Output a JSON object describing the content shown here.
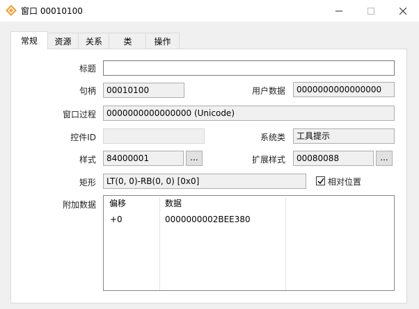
{
  "window": {
    "title": "窗口 00010100",
    "controls": [
      "minimize",
      "maximize",
      "close"
    ]
  },
  "tabs": [
    {
      "label": "常规",
      "active": true
    },
    {
      "label": "资源",
      "active": false
    },
    {
      "label": "关系",
      "active": false
    },
    {
      "label": "类",
      "active": false
    },
    {
      "label": "操作",
      "active": false
    }
  ],
  "general": {
    "title_label": "标题",
    "title_value": "",
    "handle_label": "句柄",
    "handle_value": "00010100",
    "userdata_label": "用户数据",
    "userdata_value": "0000000000000000",
    "wndproc_label": "窗口过程",
    "wndproc_value": "0000000000000000 (Unicode)",
    "ctrlid_label": "控件ID",
    "ctrlid_value": "",
    "sysclass_label": "系统类",
    "sysclass_value": "工具提示",
    "style_label": "样式",
    "style_value": "84000001",
    "exstyle_label": "扩展样式",
    "exstyle_value": "00080088",
    "dots_label": "...",
    "rect_label": "矩形",
    "rect_value": "LT(0, 0)-RB(0, 0) [0x0]",
    "relative_label": "相对位置",
    "relative_checked": true,
    "extra_label": "附加数据"
  },
  "extra_data": {
    "columns": [
      "偏移",
      "数据"
    ],
    "rows": [
      {
        "offset": "+0",
        "data": "0000000002BEE380"
      }
    ]
  },
  "icons": {
    "app": "diamond-app-icon",
    "minimize": "minimize-icon",
    "maximize": "maximize-icon",
    "close": "close-icon",
    "check": "checkmark-icon"
  },
  "colors": {
    "app_icon": "#f0a030",
    "window_bg": "#f0f0f0",
    "panel_bg": "#ffffff"
  }
}
